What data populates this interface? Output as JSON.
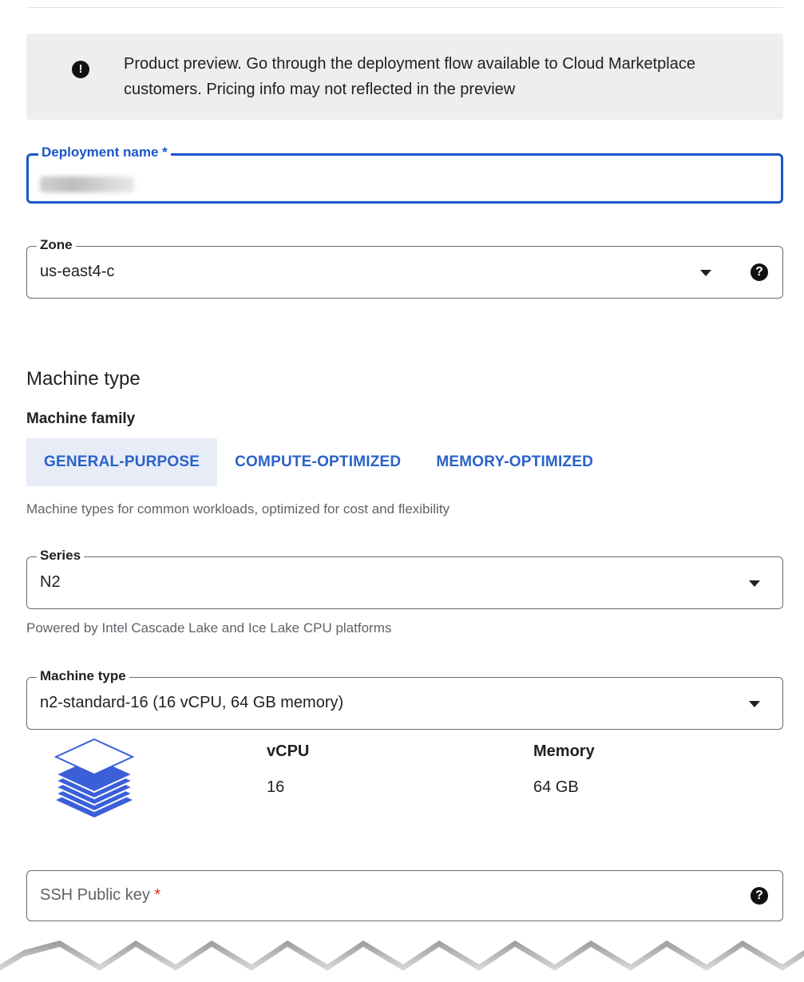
{
  "banner": {
    "icon": "info-icon",
    "text": "Product preview. Go through the deployment flow available to Cloud Marketplace customers. Pricing info may not reflected in the preview"
  },
  "deployment_name": {
    "label": "Deployment name *",
    "value_redacted": true
  },
  "zone": {
    "label": "Zone",
    "value": "us-east4-c",
    "help_icon": "help-icon"
  },
  "machine_type_section": {
    "title": "Machine type",
    "family_label": "Machine family",
    "tabs": [
      {
        "label": "GENERAL-PURPOSE",
        "active": true
      },
      {
        "label": "COMPUTE-OPTIMIZED",
        "active": false
      },
      {
        "label": "MEMORY-OPTIMIZED",
        "active": false
      }
    ],
    "family_hint": "Machine types for common workloads, optimized for cost and flexibility"
  },
  "series": {
    "label": "Series",
    "value": "N2",
    "hint": "Powered by Intel Cascade Lake and Ice Lake CPU platforms"
  },
  "machine_type": {
    "label": "Machine type",
    "value": "n2-standard-16 (16 vCPU, 64 GB memory)"
  },
  "specs": {
    "icon": "stacked-layers-icon",
    "vcpu_label": "vCPU",
    "vcpu_value": "16",
    "memory_label": "Memory",
    "memory_value": "64 GB"
  },
  "ssh_key": {
    "placeholder": "SSH Public key",
    "required_mark": "*",
    "help_icon": "help-icon"
  },
  "colors": {
    "accent": "#1a56c8",
    "tab_text": "#2b62c8",
    "tab_active_bg": "#e7ecf7",
    "banner_bg": "#eeeeee",
    "required": "#d93025",
    "stack_blue": "#3b5fd9"
  }
}
